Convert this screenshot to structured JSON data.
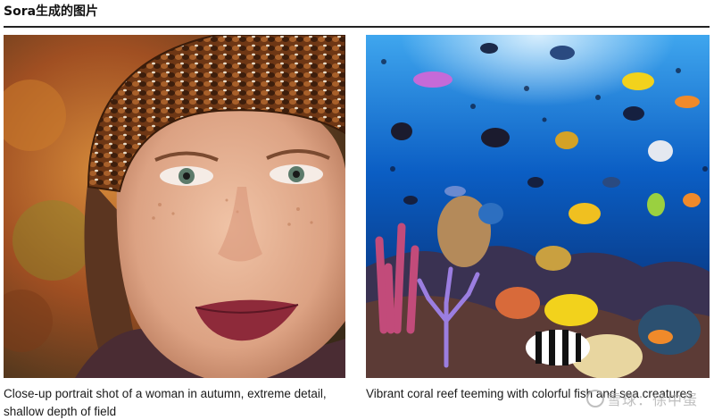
{
  "header": {
    "title": "Sora生成的图片"
  },
  "images": [
    {
      "name": "autumn-portrait",
      "caption": "Close-up portrait shot of a woman in autumn, extreme detail, shallow depth of field"
    },
    {
      "name": "coral-reef",
      "caption": "Vibrant coral reef teeming with colorful fish and sea creatures"
    }
  ],
  "watermark": {
    "text": "雪球：徐中蛋"
  },
  "colors": {
    "rule": "#222222",
    "autumn_background": "#b6622a",
    "beanie": "#7a3e1a",
    "lips": "#8e2a3a",
    "ocean_light": "#3fa6ee",
    "ocean_deep": "#06205a"
  }
}
